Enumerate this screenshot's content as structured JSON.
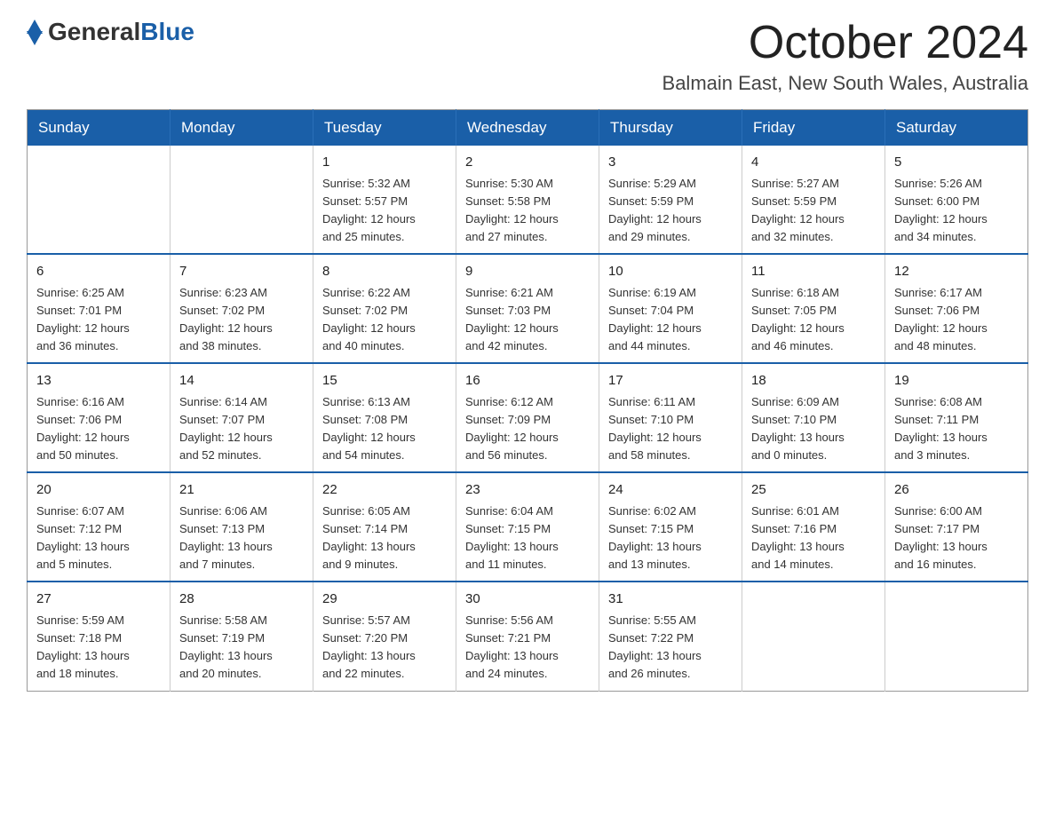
{
  "header": {
    "logo_general": "General",
    "logo_blue": "Blue",
    "month_title": "October 2024",
    "location": "Balmain East, New South Wales, Australia"
  },
  "calendar": {
    "days_of_week": [
      "Sunday",
      "Monday",
      "Tuesday",
      "Wednesday",
      "Thursday",
      "Friday",
      "Saturday"
    ],
    "weeks": [
      {
        "days": [
          {
            "number": "",
            "info": ""
          },
          {
            "number": "",
            "info": ""
          },
          {
            "number": "1",
            "info": "Sunrise: 5:32 AM\nSunset: 5:57 PM\nDaylight: 12 hours\nand 25 minutes."
          },
          {
            "number": "2",
            "info": "Sunrise: 5:30 AM\nSunset: 5:58 PM\nDaylight: 12 hours\nand 27 minutes."
          },
          {
            "number": "3",
            "info": "Sunrise: 5:29 AM\nSunset: 5:59 PM\nDaylight: 12 hours\nand 29 minutes."
          },
          {
            "number": "4",
            "info": "Sunrise: 5:27 AM\nSunset: 5:59 PM\nDaylight: 12 hours\nand 32 minutes."
          },
          {
            "number": "5",
            "info": "Sunrise: 5:26 AM\nSunset: 6:00 PM\nDaylight: 12 hours\nand 34 minutes."
          }
        ]
      },
      {
        "days": [
          {
            "number": "6",
            "info": "Sunrise: 6:25 AM\nSunset: 7:01 PM\nDaylight: 12 hours\nand 36 minutes."
          },
          {
            "number": "7",
            "info": "Sunrise: 6:23 AM\nSunset: 7:02 PM\nDaylight: 12 hours\nand 38 minutes."
          },
          {
            "number": "8",
            "info": "Sunrise: 6:22 AM\nSunset: 7:02 PM\nDaylight: 12 hours\nand 40 minutes."
          },
          {
            "number": "9",
            "info": "Sunrise: 6:21 AM\nSunset: 7:03 PM\nDaylight: 12 hours\nand 42 minutes."
          },
          {
            "number": "10",
            "info": "Sunrise: 6:19 AM\nSunset: 7:04 PM\nDaylight: 12 hours\nand 44 minutes."
          },
          {
            "number": "11",
            "info": "Sunrise: 6:18 AM\nSunset: 7:05 PM\nDaylight: 12 hours\nand 46 minutes."
          },
          {
            "number": "12",
            "info": "Sunrise: 6:17 AM\nSunset: 7:06 PM\nDaylight: 12 hours\nand 48 minutes."
          }
        ]
      },
      {
        "days": [
          {
            "number": "13",
            "info": "Sunrise: 6:16 AM\nSunset: 7:06 PM\nDaylight: 12 hours\nand 50 minutes."
          },
          {
            "number": "14",
            "info": "Sunrise: 6:14 AM\nSunset: 7:07 PM\nDaylight: 12 hours\nand 52 minutes."
          },
          {
            "number": "15",
            "info": "Sunrise: 6:13 AM\nSunset: 7:08 PM\nDaylight: 12 hours\nand 54 minutes."
          },
          {
            "number": "16",
            "info": "Sunrise: 6:12 AM\nSunset: 7:09 PM\nDaylight: 12 hours\nand 56 minutes."
          },
          {
            "number": "17",
            "info": "Sunrise: 6:11 AM\nSunset: 7:10 PM\nDaylight: 12 hours\nand 58 minutes."
          },
          {
            "number": "18",
            "info": "Sunrise: 6:09 AM\nSunset: 7:10 PM\nDaylight: 13 hours\nand 0 minutes."
          },
          {
            "number": "19",
            "info": "Sunrise: 6:08 AM\nSunset: 7:11 PM\nDaylight: 13 hours\nand 3 minutes."
          }
        ]
      },
      {
        "days": [
          {
            "number": "20",
            "info": "Sunrise: 6:07 AM\nSunset: 7:12 PM\nDaylight: 13 hours\nand 5 minutes."
          },
          {
            "number": "21",
            "info": "Sunrise: 6:06 AM\nSunset: 7:13 PM\nDaylight: 13 hours\nand 7 minutes."
          },
          {
            "number": "22",
            "info": "Sunrise: 6:05 AM\nSunset: 7:14 PM\nDaylight: 13 hours\nand 9 minutes."
          },
          {
            "number": "23",
            "info": "Sunrise: 6:04 AM\nSunset: 7:15 PM\nDaylight: 13 hours\nand 11 minutes."
          },
          {
            "number": "24",
            "info": "Sunrise: 6:02 AM\nSunset: 7:15 PM\nDaylight: 13 hours\nand 13 minutes."
          },
          {
            "number": "25",
            "info": "Sunrise: 6:01 AM\nSunset: 7:16 PM\nDaylight: 13 hours\nand 14 minutes."
          },
          {
            "number": "26",
            "info": "Sunrise: 6:00 AM\nSunset: 7:17 PM\nDaylight: 13 hours\nand 16 minutes."
          }
        ]
      },
      {
        "days": [
          {
            "number": "27",
            "info": "Sunrise: 5:59 AM\nSunset: 7:18 PM\nDaylight: 13 hours\nand 18 minutes."
          },
          {
            "number": "28",
            "info": "Sunrise: 5:58 AM\nSunset: 7:19 PM\nDaylight: 13 hours\nand 20 minutes."
          },
          {
            "number": "29",
            "info": "Sunrise: 5:57 AM\nSunset: 7:20 PM\nDaylight: 13 hours\nand 22 minutes."
          },
          {
            "number": "30",
            "info": "Sunrise: 5:56 AM\nSunset: 7:21 PM\nDaylight: 13 hours\nand 24 minutes."
          },
          {
            "number": "31",
            "info": "Sunrise: 5:55 AM\nSunset: 7:22 PM\nDaylight: 13 hours\nand 26 minutes."
          },
          {
            "number": "",
            "info": ""
          },
          {
            "number": "",
            "info": ""
          }
        ]
      }
    ]
  }
}
